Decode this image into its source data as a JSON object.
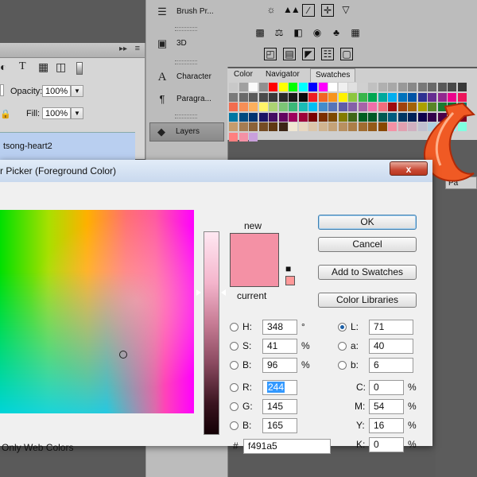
{
  "layers_panel": {
    "opacity_label": "Opacity:",
    "opacity_value": "100%",
    "fill_label": "Fill:",
    "fill_value": "100%",
    "layer_name": "tsong-heart2",
    "type_tool_glyph": "T"
  },
  "side_panels": [
    {
      "label": "Brush Pr...",
      "icon": "brush-presets-icon"
    },
    {
      "label": "3D",
      "icon": "cube-3d-icon"
    },
    {
      "label": "Character",
      "icon": "character-icon"
    },
    {
      "label": "Paragra...",
      "icon": "paragraph-icon"
    },
    {
      "label": "Layers",
      "icon": "layers-icon"
    }
  ],
  "swatch_tabs": [
    "Color",
    "Navigator",
    "Swatches"
  ],
  "swatch_active_tab": "Swatches",
  "swatch_rows": [
    [
      "#c8c8c8",
      "#a0a0a0",
      "#fafafa",
      "#909090",
      "#ff0000",
      "#ffff00",
      "#00ff00",
      "#00ffff",
      "#0000ff",
      "#ff00ff",
      "#ffffff",
      "#f0f0f0",
      "#e0e0e0",
      "#d0d0d0",
      "#c0c0c0",
      "#b0b0b0",
      "#a8a8a8",
      "#989898",
      "#888888",
      "#787878",
      "#686868",
      "#585858",
      "#484848",
      "#383838"
    ],
    [
      "#7a7a7a",
      "#6a6a6a",
      "#5a5a5a",
      "#4a4a4a",
      "#3a3a3a",
      "#2a2a2a",
      "#1a1a1a",
      "#0a0a0a",
      "#ed1c24",
      "#f26522",
      "#f7941d",
      "#fff200",
      "#8dc63f",
      "#39b54a",
      "#00a651",
      "#00a99d",
      "#00aeef",
      "#0072bc",
      "#0054a6",
      "#2e3192",
      "#662d91",
      "#92278f",
      "#ec008c",
      "#ed145b"
    ],
    [
      "#f26c4f",
      "#f68e56",
      "#fbaf5d",
      "#fff568",
      "#acd373",
      "#7cc576",
      "#3bb878",
      "#1abbb4",
      "#00bff3",
      "#438ccb",
      "#5574b9",
      "#605ca8",
      "#855fa8",
      "#a763a8",
      "#f06ea9",
      "#f26d7d",
      "#9e0b0f",
      "#a0410d",
      "#a36209",
      "#aba000",
      "#598527",
      "#1a7b30",
      "#007236",
      "#00746b"
    ],
    [
      "#0076a3",
      "#004a80",
      "#003471",
      "#1b1464",
      "#440e62",
      "#630460",
      "#9e005d",
      "#9e0039",
      "#790000",
      "#7b2e00",
      "#7d4900",
      "#827b00",
      "#406618",
      "#005e20",
      "#005826",
      "#005952",
      "#005b7f",
      "#003663",
      "#002157",
      "#0d004c",
      "#32004b",
      "#4b0049",
      "#7b0046",
      "#7a0026"
    ],
    [
      "#c69c6d",
      "#a67c52",
      "#8c6239",
      "#754c24",
      "#603913",
      "#3c2415",
      "#f0e6d2",
      "#e8d8c0",
      "#dcc6aa",
      "#d0b490",
      "#c4a278",
      "#b89060",
      "#ac7e48",
      "#a06c30",
      "#945a18",
      "#884800",
      "#f491a5",
      "#e0a0b0",
      "#d0b0c0",
      "#c0c0d0",
      "#b0d0e0",
      "#a0e0f0",
      "#90f0ff",
      "#80ffe0"
    ],
    [
      "#ff7f7f",
      "#f491a5",
      "#c9a0dc"
    ]
  ],
  "dialog": {
    "title": "r Picker (Foreground Color)",
    "close_glyph": "x",
    "new_label": "new",
    "current_label": "current",
    "buttons": {
      "ok": "OK",
      "cancel": "Cancel",
      "add_to_swatches": "Add to Swatches",
      "color_libraries": "Color Libraries"
    },
    "fields": {
      "H": {
        "label": "H:",
        "value": "348",
        "unit": "°"
      },
      "S": {
        "label": "S:",
        "value": "41",
        "unit": "%"
      },
      "B": {
        "label": "B:",
        "value": "96",
        "unit": "%"
      },
      "R": {
        "label": "R:",
        "value": "244"
      },
      "G": {
        "label": "G:",
        "value": "145"
      },
      "Bl": {
        "label": "B:",
        "value": "165"
      },
      "L": {
        "label": "L:",
        "value": "71"
      },
      "a": {
        "label": "a:",
        "value": "40"
      },
      "b": {
        "label": "b:",
        "value": "6"
      },
      "C": {
        "label": "C:",
        "value": "0",
        "unit": "%"
      },
      "M": {
        "label": "M:",
        "value": "54",
        "unit": "%"
      },
      "Y": {
        "label": "Y:",
        "value": "16",
        "unit": "%"
      },
      "K": {
        "label": "K:",
        "value": "0",
        "unit": "%"
      }
    },
    "hex_label": "#",
    "hex_value": "f491a5",
    "web_colors_label": "Only Web Colors",
    "selected_radio": "L",
    "current_color": "#f491a5",
    "websafe_color": "#ff9999"
  },
  "right_tab_label": "Pa"
}
